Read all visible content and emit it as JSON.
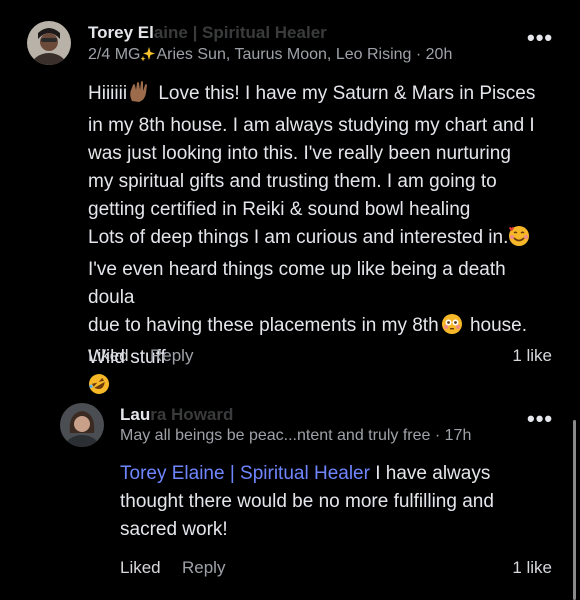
{
  "comment": {
    "author_first": "Torey El",
    "author_rest": "aine | Spiritual Healer",
    "subtitle_prefix": "2/4 MG",
    "subtitle_rest": "Aries Sun, Taurus Moon, Leo Rising",
    "time": "20h",
    "more_label": "•••",
    "lines": [
      "Hiiiiii",
      "Love this! I have my Saturn & Mars in Pisces",
      "in my 8th house. I am always studying my chart and I",
      "was just looking into this. I've really been nurturing",
      "my spiritual gifts and trusting them. I am going to",
      "getting certified in Reiki & sound bowl healing",
      "Lots of deep things I am curious and interested in.",
      "I've even heard things come up like being a death",
      "doula",
      "due to having these placements in my 8th",
      "house. Wild stuff"
    ],
    "liked_label": "Liked",
    "reply_label": "Reply",
    "likes": "1 like",
    "emojis": [
      "waving-hand-emoji",
      "smiling-face-with-hearts-emoji",
      "flushed-face-emoji",
      "rolling-on-floor-laughing-emoji"
    ]
  },
  "reply": {
    "author_first": "Lau",
    "author_rest": "ra Howard",
    "subtitle": "May all beings be peac...ntent and truly free",
    "time": "17h",
    "more_label": "•••",
    "mention": "Torey Elaine | Spiritual Healer",
    "line1_rest": " I have always",
    "line2": "thought there would be no more fulfilling and",
    "line3": "sacred work!",
    "liked_label": "Liked",
    "reply_label": "Reply",
    "likes": "1 like"
  },
  "separator": "·",
  "colors": {
    "background": "#000000",
    "text": "#e4e6eb",
    "muted": "#9ea2a8",
    "mention": "#6f86ff"
  }
}
